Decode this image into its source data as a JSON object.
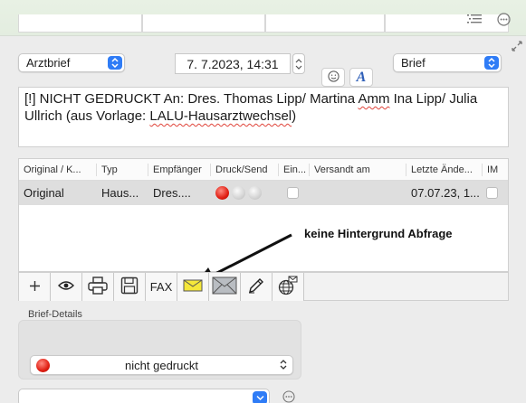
{
  "header": {
    "list_icon": "list-icon",
    "more_icon": "ellipsis-circle-icon"
  },
  "form": {
    "doc_type": "Arztbrief",
    "datetime": "7.  7.2023, 14:31",
    "category": "Brief",
    "emoji_icon": "smiley-icon",
    "font_button_label": "A",
    "body_text_part1": "[!] NICHT GEDRUCKT An:  Dres. Thomas Lipp/ Martina ",
    "body_text_amm": "Amm",
    "body_text_part2": " Ina Lipp/ Julia Ullrich (aus Vorlage: ",
    "body_text_template": "LALU-Hausarztwechsel",
    "body_text_part3": ")"
  },
  "table": {
    "columns": [
      "Original / K...",
      "Typ",
      "Empfänger",
      "Druck/Send",
      "Ein...",
      "Versandt am",
      "Letzte Ände...",
      "IM"
    ],
    "rows": [
      {
        "original": "Original",
        "typ": "Haus...",
        "empfaenger": "Dres....",
        "druck_status": [
          "red",
          "gray",
          "gray"
        ],
        "ein": false,
        "versandt": "",
        "letzte": "07.07.23, 1...",
        "im": false
      }
    ]
  },
  "annotation": "keine Hintergrund Abfrage",
  "toolbar": {
    "fax_label": "FAX",
    "buttons": [
      "plus-icon",
      "eye-icon",
      "printer-icon",
      "save-disk-icon",
      "fax",
      "envelope-yellow-icon",
      "envelope-gray-icon",
      "pencil-icon",
      "globe-mail-icon"
    ]
  },
  "details": {
    "label": "Brief-Details",
    "status": "nicht gedruckt"
  },
  "colors": {
    "accent": "#2f7cf6",
    "status_red": "#e01e12",
    "top_strip": "#e5efe2"
  }
}
